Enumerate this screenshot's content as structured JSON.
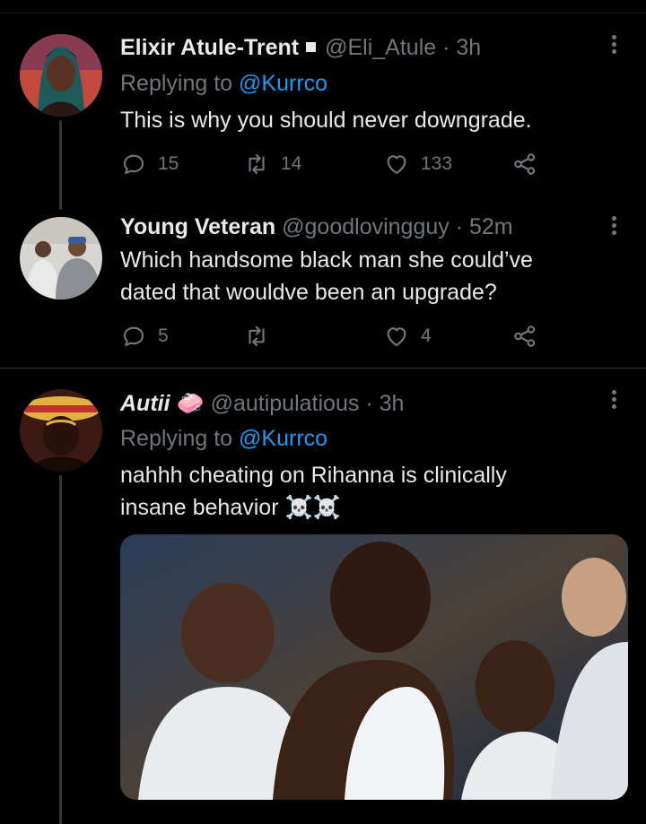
{
  "tweets": [
    {
      "name": "Elixir Atule-Trent",
      "handle": "@Eli_Atule",
      "separator": "·",
      "time": "3h",
      "replying_prefix": "Replying to",
      "replying_to": "@Kurrco",
      "text": "This is why you should never downgrade.",
      "actions": {
        "replies": "15",
        "retweets": "14",
        "likes": "133"
      }
    },
    {
      "name": "Young Veteran",
      "handle": "@goodlovingguy",
      "separator": "·",
      "time": "52m",
      "text_line1": "Which handsome black man she could’ve",
      "text_line2": "dated that wouldve been an upgrade?",
      "actions": {
        "replies": "5",
        "retweets": "",
        "likes": "4"
      }
    },
    {
      "name": "Autii",
      "handle": "@autipulatious",
      "separator": "·",
      "time": "3h",
      "replying_prefix": "Replying to",
      "replying_to": "@Kurrco",
      "text_line1": "nahhh cheating on Rihanna is clinically",
      "text_line2": "insane behavior",
      "emoji": "☠️☠️",
      "name_emoji": "🧼"
    }
  ],
  "colors": {
    "background": "#000000",
    "text": "#e7e9ea",
    "muted": "#71767b",
    "link": "#1d9bf0",
    "divider": "#2f3336"
  }
}
